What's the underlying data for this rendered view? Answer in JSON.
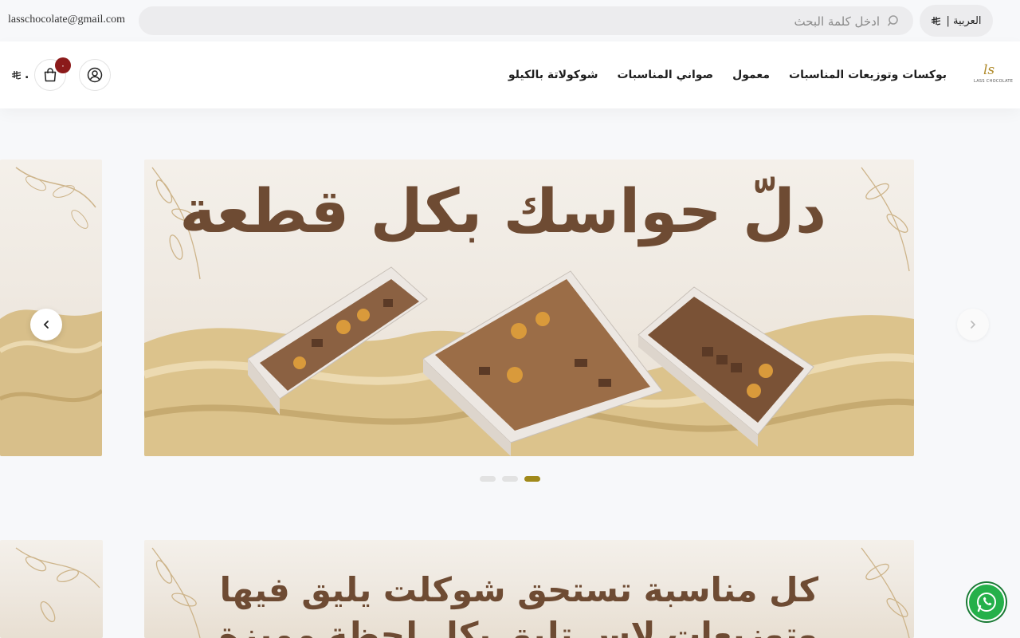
{
  "header": {
    "email": "lasschocolate@gmail.com",
    "search_placeholder": "ادخل كلمة البحث",
    "language_label": "العربية |",
    "currency_symbol_icon": "riyal-icon"
  },
  "nav": {
    "logo_mark": "ls",
    "logo_text": "LASS CHOCOLATE",
    "items": [
      {
        "label": "بوكسات وتوزيعات المناسبات"
      },
      {
        "label": "معمول"
      },
      {
        "label": "صواني المناسبات"
      },
      {
        "label": "شوكولاتة بالكيلو"
      }
    ],
    "cart_count": "٠",
    "cart_total": "."
  },
  "slider": {
    "slide_1_headline": "دلّ حواسك بكل قطعة",
    "slide_2_line_1": "كل مناسبة تستحق شوكلت يليق فيها",
    "slide_2_line_2": "وتوزيعات لاس تليق بكل لحظة مميزة",
    "dots": [
      {
        "active": false
      },
      {
        "active": false
      },
      {
        "active": true
      }
    ],
    "accent_color": "#a0891a"
  },
  "colors": {
    "headline": "#6e4b33",
    "badge": "#8b1a1a",
    "whatsapp": "#25b04a"
  }
}
